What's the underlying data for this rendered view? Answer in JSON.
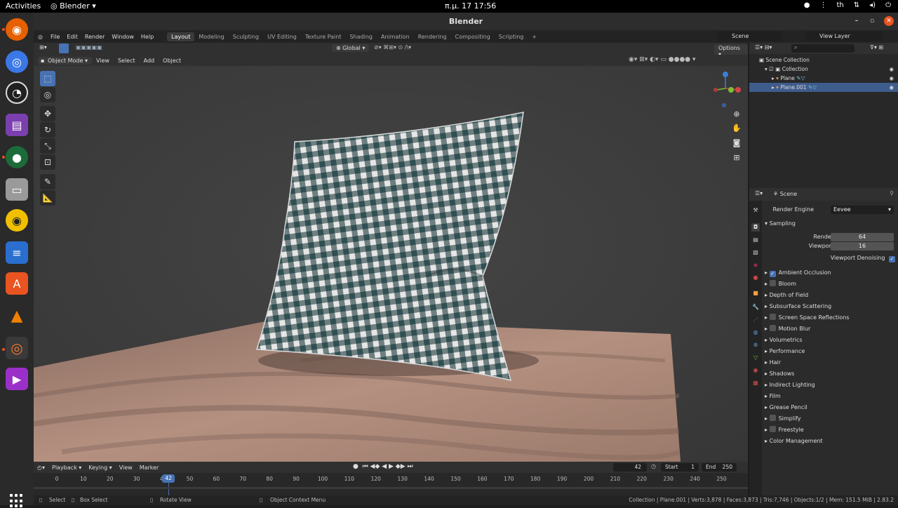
{
  "system": {
    "activities": "Activities",
    "app_name": "Blender",
    "clock": "π.μ. 17  17:56",
    "lang": "th"
  },
  "window": {
    "title": "Blender"
  },
  "menu": [
    "File",
    "Edit",
    "Render",
    "Window",
    "Help"
  ],
  "workspaces": [
    "Layout",
    "Modeling",
    "Sculpting",
    "UV Editing",
    "Texture Paint",
    "Shading",
    "Animation",
    "Rendering",
    "Compositing",
    "Scripting"
  ],
  "active_workspace": "Layout",
  "scene": {
    "name": "Scene",
    "view_layer": "View Layer"
  },
  "viewport_header": {
    "transform": "Global",
    "options": "Options",
    "mode": "Object Mode",
    "menus": [
      "View",
      "Select",
      "Add",
      "Object"
    ]
  },
  "outliner": {
    "root": "Scene Collection",
    "collection": "Collection",
    "items": [
      "Plane",
      "Plane.001"
    ]
  },
  "properties": {
    "breadcrumb": "Scene",
    "render_engine_label": "Render Engine",
    "render_engine": "Eevee",
    "sampling": "Sampling",
    "render_label": "Render",
    "render_value": "64",
    "viewport_label": "Viewport",
    "viewport_value": "16",
    "viewport_denoising": "Viewport Denoising",
    "panels": [
      {
        "label": "Ambient Occlusion",
        "check": "on"
      },
      {
        "label": "Bloom",
        "check": "off"
      },
      {
        "label": "Depth of Field",
        "check": "none"
      },
      {
        "label": "Subsurface Scattering",
        "check": "none"
      },
      {
        "label": "Screen Space Reflections",
        "check": "off"
      },
      {
        "label": "Motion Blur",
        "check": "off"
      },
      {
        "label": "Volumetrics",
        "check": "none"
      },
      {
        "label": "Performance",
        "check": "none"
      },
      {
        "label": "Hair",
        "check": "none"
      },
      {
        "label": "Shadows",
        "check": "none"
      },
      {
        "label": "Indirect Lighting",
        "check": "none"
      },
      {
        "label": "Film",
        "check": "none"
      },
      {
        "label": "Grease Pencil",
        "check": "none"
      },
      {
        "label": "Simplify",
        "check": "off"
      },
      {
        "label": "Freestyle",
        "check": "off"
      },
      {
        "label": "Color Management",
        "check": "none"
      }
    ]
  },
  "timeline": {
    "menus": [
      "Playback",
      "Keying",
      "View",
      "Marker"
    ],
    "current_frame": "42",
    "start_label": "Start",
    "start": "1",
    "end_label": "End",
    "end": "250",
    "ticks": [
      "0",
      "10",
      "20",
      "30",
      "40",
      "50",
      "60",
      "70",
      "80",
      "90",
      "100",
      "110",
      "120",
      "130",
      "140",
      "150",
      "160",
      "170",
      "180",
      "190",
      "200",
      "210",
      "220",
      "230",
      "240",
      "250"
    ]
  },
  "status": {
    "select": "Select",
    "box_select": "Box Select",
    "rotate_view": "Rotate View",
    "context_menu": "Object Context Menu",
    "stats": "Collection | Plane.001 | Verts:3,878 | Faces:3,873 | Tris:7,746 | Objects:1/2 | Mem: 151.5 MiB | 2.83.2"
  },
  "colors": {
    "accent": "#4772b3",
    "ubuntu_orange": "#e95420",
    "pillow_dark": "#2f4f52",
    "pillow_light": "#e6e6e6",
    "wood": "#a58473"
  }
}
